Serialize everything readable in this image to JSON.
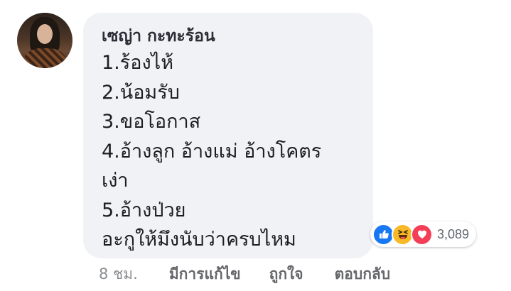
{
  "comment": {
    "author": "เซญ่า กะทะร้อน",
    "lines": [
      "1.ร้องไห้",
      "2.น้อมรับ",
      "3.ขอโอกาส",
      "4.อ้างลูก อ้างแม่ อ้างโคตร",
      "เง่า",
      "5.อ้างป่วย",
      "อะกูให้มึงนับว่าครบไหม"
    ]
  },
  "reactions": {
    "icons": [
      "like-icon",
      "haha-icon",
      "love-icon"
    ],
    "colors": {
      "like": "#1877f2",
      "haha": "#f7b928",
      "love": "#f33e58"
    },
    "count": "3,089"
  },
  "meta": {
    "time": "8 ชม.",
    "edited": "มีการแก้ไข",
    "like": "ถูกใจ",
    "reply": "ตอบกลับ"
  }
}
